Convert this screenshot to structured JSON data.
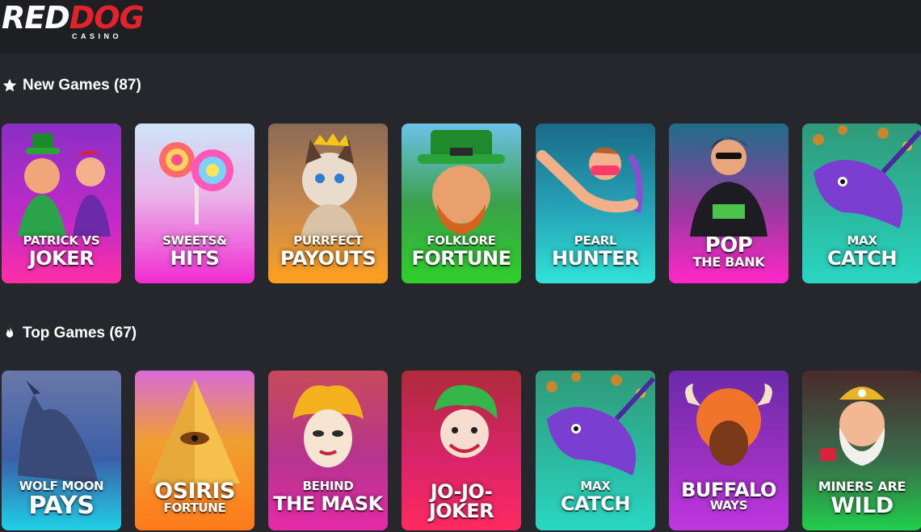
{
  "header": {
    "logo_red": "RED",
    "logo_dog": "DOG",
    "logo_sub": "CASINO"
  },
  "sections": {
    "new": {
      "title": "New Games (87)",
      "icon": "star-icon"
    },
    "top": {
      "title": "Top Games (67)",
      "icon": "fire-icon"
    }
  },
  "new_games": [
    {
      "line1": "PATRICK VS",
      "line2": "JOKER"
    },
    {
      "line1": "SWEETS&",
      "line2": "HITS"
    },
    {
      "line1": "PURRFECT",
      "line2": "PAYOUTS"
    },
    {
      "line1": "FOLKLORE",
      "line2": "FORTUNE"
    },
    {
      "line1": "PEARL",
      "line2": "HUNTER"
    },
    {
      "line1": "POP",
      "line2": "THE BANK"
    },
    {
      "line1": "MAX",
      "line2": "CATCH"
    }
  ],
  "top_games": [
    {
      "line1": "WOLF MOON",
      "line2": "PAYS"
    },
    {
      "line1": "OSIRIS",
      "line2": "FORTUNE"
    },
    {
      "line1": "BEHIND",
      "line2": "THE MASK"
    },
    {
      "line1": "",
      "line2": "JO-JO-JOKER"
    },
    {
      "line1": "MAX",
      "line2": "CATCH"
    },
    {
      "line1": "BUFFALO",
      "line2": "WAYS"
    },
    {
      "line1": "MINERS ARE",
      "line2": "WILD"
    }
  ],
  "colors": {
    "background": "#25272d",
    "topbar": "#1d1f23",
    "brand_red": "#e4222c"
  }
}
